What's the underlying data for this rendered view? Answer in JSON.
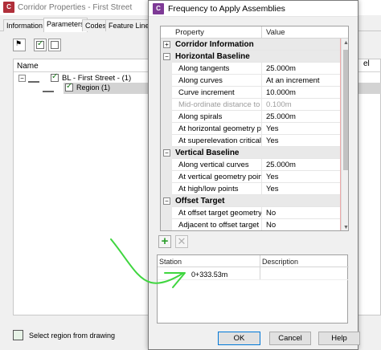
{
  "background_window": {
    "title": "Corridor Properties - First Street",
    "tabs": [
      "Information",
      "Parameters",
      "Codes",
      "Feature Lines"
    ],
    "active_tab": "Parameters",
    "tree_header": "Name",
    "tree_items": [
      "BL - First Street - (1)",
      "Region (1)"
    ],
    "right_edge_text": "el",
    "status_text": "Select region from drawing"
  },
  "dialog": {
    "title": "Frequency to Apply Assemblies",
    "grid": {
      "headers": [
        "Property",
        "Value"
      ],
      "rows": [
        {
          "type": "cat",
          "expand": "+",
          "label": "Corridor Information"
        },
        {
          "type": "cat",
          "expand": "−",
          "label": "Horizontal Baseline"
        },
        {
          "type": "prop",
          "label": "Along tangents",
          "value": "25.000m"
        },
        {
          "type": "prop",
          "label": "Along curves",
          "value": "At an increment"
        },
        {
          "type": "prop",
          "label": "Curve increment",
          "value": "10.000m"
        },
        {
          "type": "prop",
          "label": "Mid-ordinate distance to",
          "value": "0.100m",
          "disabled": true
        },
        {
          "type": "prop",
          "label": "Along spirals",
          "value": "25.000m"
        },
        {
          "type": "prop",
          "label": "At horizontal geometry p",
          "value": "Yes"
        },
        {
          "type": "prop",
          "label": "At superelevation critical",
          "value": "Yes"
        },
        {
          "type": "cat",
          "expand": "−",
          "label": "Vertical Baseline"
        },
        {
          "type": "prop",
          "label": "Along vertical curves",
          "value": "25.000m"
        },
        {
          "type": "prop",
          "label": "At vertical geometry points",
          "value": "Yes"
        },
        {
          "type": "prop",
          "label": "At high/low points",
          "value": "Yes"
        },
        {
          "type": "cat",
          "expand": "−",
          "label": "Offset Target"
        },
        {
          "type": "prop",
          "label": "At offset target geometry",
          "value": "No"
        },
        {
          "type": "prop",
          "label": "Adjacent to offset target",
          "value": "No"
        }
      ]
    },
    "station_table": {
      "headers": [
        "Station",
        "Description"
      ],
      "rows": [
        {
          "station": "0+333.53m",
          "description": ""
        }
      ]
    },
    "buttons": {
      "ok": "OK",
      "cancel": "Cancel",
      "help": "Help"
    }
  },
  "colors": {
    "annotation": "#3fd63f",
    "dialog_icon": "#7e3a96",
    "bg_icon": "#b02f3a",
    "add_icon": "#2a9d2a"
  },
  "icons": [
    "app-icon",
    "expand-plus-icon",
    "collapse-minus-icon",
    "add-icon",
    "delete-icon",
    "checkbox-icon",
    "baseline-icon",
    "region-icon"
  ]
}
